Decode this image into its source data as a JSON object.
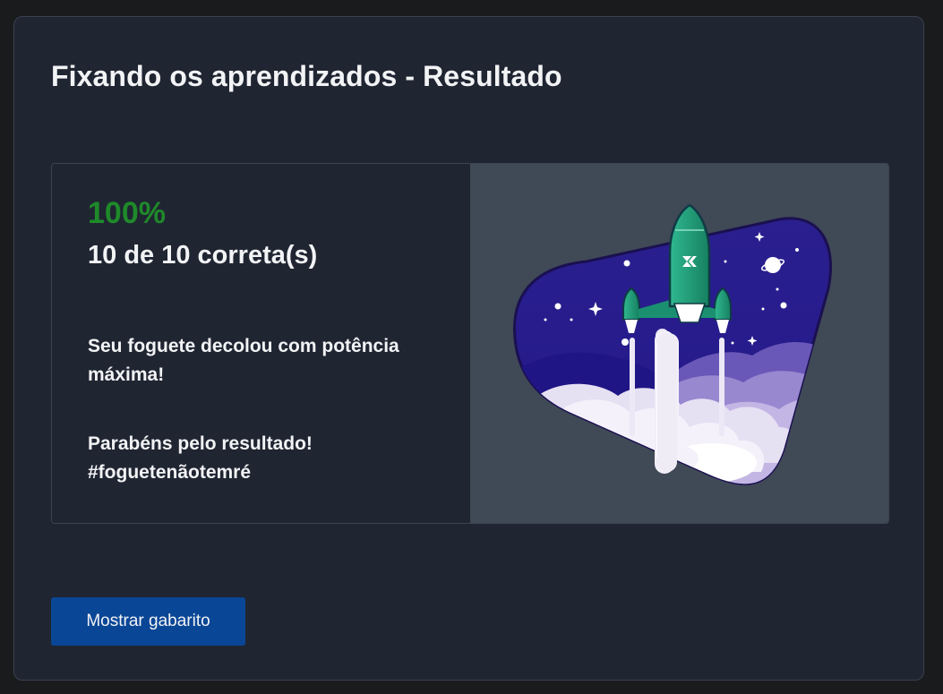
{
  "page": {
    "title": "Fixando os aprendizados - Resultado"
  },
  "result": {
    "percent": "100%",
    "score": "10 de 10 correta(s)",
    "message_1": "Seu foguete decolou com potência máxima!",
    "message_2": "Parabéns pelo resultado! #foguetenãotemré"
  },
  "actions": {
    "show_answers_label": "Mostrar gabarito"
  },
  "colors": {
    "page_background": "#1a1b1d",
    "card_background": "#202532",
    "percent_green": "#1f8a2a",
    "button_blue": "#0a4696",
    "image_panel": "#404956"
  },
  "illustration": {
    "icon": "rocket-launch-illustration"
  }
}
